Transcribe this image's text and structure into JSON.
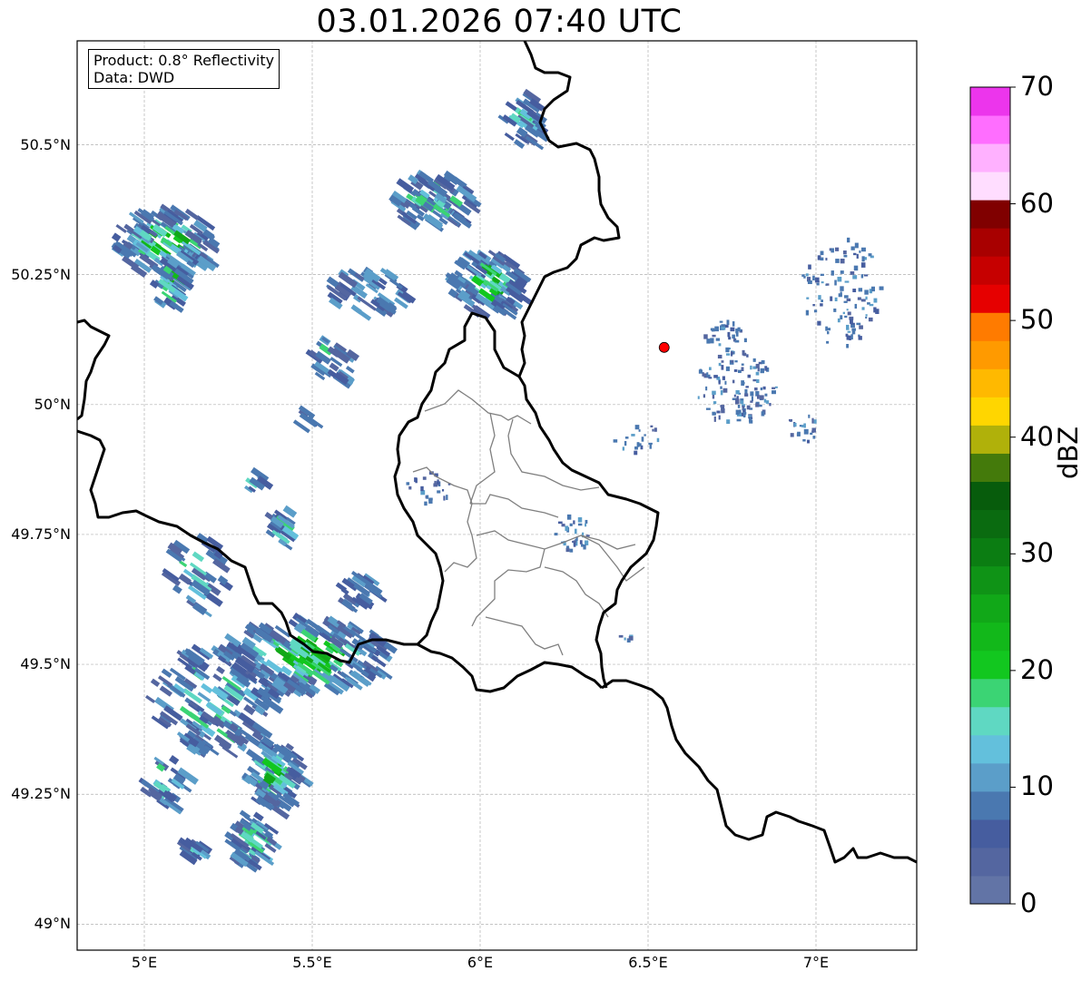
{
  "title": "03.01.2026 07:40 UTC",
  "info": {
    "product": "Product: 0.8° Reflectivity",
    "data_source": "Data: DWD"
  },
  "map": {
    "lon_range": [
      4.8,
      7.3
    ],
    "lat_range": [
      48.95,
      50.7
    ],
    "lat_ticks": [
      {
        "value": 49.0,
        "label": "49°N"
      },
      {
        "value": 49.25,
        "label": "49.25°N"
      },
      {
        "value": 49.5,
        "label": "49.5°N"
      },
      {
        "value": 49.75,
        "label": "49.75°N"
      },
      {
        "value": 50.0,
        "label": "50°N"
      },
      {
        "value": 50.25,
        "label": "50.25°N"
      },
      {
        "value": 50.5,
        "label": "50.5°N"
      }
    ],
    "lon_ticks": [
      {
        "value": 5.0,
        "label": "5°E"
      },
      {
        "value": 5.5,
        "label": "5.5°E"
      },
      {
        "value": 6.0,
        "label": "6°E"
      },
      {
        "value": 6.5,
        "label": "6.5°E"
      },
      {
        "value": 7.0,
        "label": "7°E"
      }
    ],
    "gridlines": true,
    "radar_site": {
      "lon": 6.548,
      "lat": 50.11,
      "color": "#ff0000"
    }
  },
  "colorbar": {
    "label": "dBZ",
    "min": 0,
    "max": 70,
    "tick_labels": [
      "0",
      "10",
      "20",
      "30",
      "40",
      "50",
      "60",
      "70"
    ],
    "colors": [
      "#6274a6",
      "#5466a0",
      "#465d9f",
      "#4a78b0",
      "#5b9ec9",
      "#63c0dc",
      "#5fd8c2",
      "#3bd474",
      "#12c71f",
      "#12b81a",
      "#11a818",
      "#0f9316",
      "#0b7d12",
      "#0a6b10",
      "#075c0c",
      "#447a0b",
      "#b0b10a",
      "#ffd600",
      "#ffb900",
      "#ff9a00",
      "#ff7b00",
      "#e60000",
      "#c60000",
      "#a80000",
      "#800000",
      "#ffddff",
      "#ffb1ff",
      "#ff6eff",
      "#ec35ec"
    ]
  }
}
